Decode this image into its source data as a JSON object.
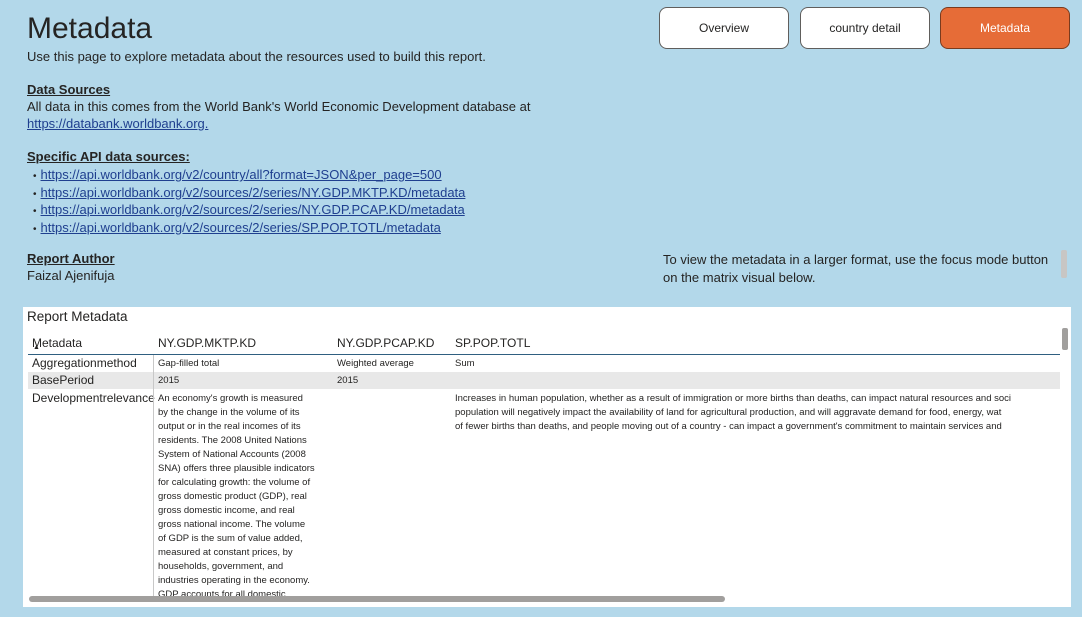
{
  "page": {
    "title": "Metadata",
    "subtitle": "Use this page to explore metadata about the resources used  to build this report."
  },
  "nav": {
    "overview": "Overview",
    "country_detail": "country detail",
    "metadata": "Metadata",
    "active_color": "#e66c37"
  },
  "data_sources": {
    "heading": "Data Sources",
    "text": "All data in this comes from the World Bank's World Economic Development database at",
    "link": "https://databank.worldbank.org."
  },
  "api_sources": {
    "heading": "Specific API data sources:",
    "links": [
      "https://api.worldbank.org/v2/country/all?format=JSON&per_page=500",
      "https://api.worldbank.org/v2/sources/2/series/NY.GDP.MKTP.KD/metadata",
      "https://api.worldbank.org/v2/sources/2/series/NY.GDP.PCAP.KD/metadata",
      "https://api.worldbank.org/v2/sources/2/series/SP.POP.TOTL/metadata"
    ]
  },
  "author": {
    "heading": "Report Author",
    "name": "Faizal Ajenifuja"
  },
  "side_note": "To view the metadata in a larger format, use the focus mode button on the matrix visual below.",
  "matrix": {
    "title": "Report Metadata",
    "columns": [
      "Metadata",
      "NY.GDP.MKTP.KD",
      "NY.GDP.PCAP.KD",
      "SP.POP.TOTL"
    ],
    "rows": [
      {
        "label": "Aggregationmethod",
        "values": [
          "Gap-filled total",
          "Weighted average",
          "Sum"
        ]
      },
      {
        "label": "BasePeriod",
        "values": [
          "2015",
          "2015",
          ""
        ]
      },
      {
        "label": "Developmentrelevance",
        "values": [
          "An economy's growth is measured by the change in the volume of its output or in the real incomes of its residents. The 2008 United Nations System of National Accounts (2008 SNA) offers three plausible indicators for calculating growth: the volume of gross domestic product (GDP), real gross domestic income, and real gross national income. The volume of GDP is the sum of value added, measured at constant prices, by households, government, and industries operating in the economy. GDP accounts for all domestic",
          "",
          "Increases in human population, whether as a result of immigration or more births than deaths, can impact natural resources and soci population will negatively impact the availability of land for agricultural production, and will aggravate demand for food, energy, wat of fewer births than deaths, and people moving out of a country - can impact a government's commitment to maintain services and"
        ]
      }
    ],
    "dev_lines_gdp": [
      "An economy's growth is measured",
      "by the change in the volume of its",
      "output or in the real incomes of its",
      "residents. The 2008 United Nations",
      "System of National Accounts (2008",
      "SNA) offers three plausible indicators",
      "for calculating growth: the volume of",
      "gross domestic product (GDP), real",
      "gross domestic income, and real",
      "gross national income. The volume",
      "of GDP is the sum of value added,",
      "measured at constant prices, by",
      "households, government, and",
      "industries operating in the economy.",
      "GDP accounts for all domestic"
    ],
    "dev_lines_pop": [
      "Increases in human population, whether as a result of immigration or more births than deaths, can impact natural resources and soci",
      "population will negatively impact the availability of land for agricultural production, and will aggravate demand for food, energy, wat",
      "of fewer births than deaths, and people moving out of a country - can impact a government's commitment to maintain services and"
    ]
  }
}
